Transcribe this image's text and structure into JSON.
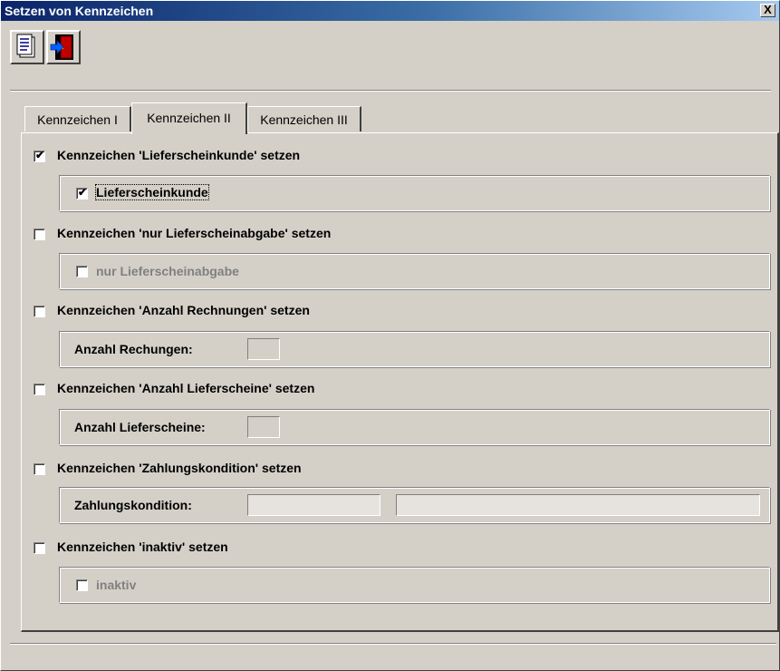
{
  "window": {
    "title": "Setzen von Kennzeichen",
    "close_label": "X"
  },
  "toolbar": {
    "buttons": [
      {
        "icon": "document-icon"
      },
      {
        "icon": "exit-door-icon"
      }
    ]
  },
  "tabs": [
    {
      "label": "Kennzeichen I",
      "active": false
    },
    {
      "label": "Kennzeichen II",
      "active": true
    },
    {
      "label": "Kennzeichen III",
      "active": false
    }
  ],
  "sections": [
    {
      "label": "Kennzeichen 'Lieferscheinkunde' setzen",
      "checked": true,
      "group": {
        "label": "Lieferscheinkunde",
        "checked": true
      }
    },
    {
      "label": "Kennzeichen 'nur Lieferscheinabgabe' setzen",
      "checked": false,
      "group": {
        "label": "nur Lieferscheinabgabe",
        "checked": false
      }
    },
    {
      "label": "Kennzeichen 'Anzahl Rechnungen' setzen",
      "checked": false,
      "group": {
        "label": "Anzahl Rechungen:",
        "value": ""
      }
    },
    {
      "label": "Kennzeichen 'Anzahl Lieferscheine' setzen",
      "checked": false,
      "group": {
        "label": "Anzahl Lieferscheine:",
        "value": ""
      }
    },
    {
      "label": "Kennzeichen 'Zahlungskondition' setzen",
      "checked": false,
      "group": {
        "label": "Zahlungskondition:",
        "code": "",
        "description": ""
      }
    },
    {
      "label": "Kennzeichen 'inaktiv' setzen",
      "checked": false,
      "group": {
        "label": "inaktiv",
        "checked": false
      }
    }
  ],
  "check_glyph": "✔",
  "colors": {
    "title_start": "#0a246a",
    "title_end": "#a6caf0",
    "face": "#d4d0c8"
  }
}
